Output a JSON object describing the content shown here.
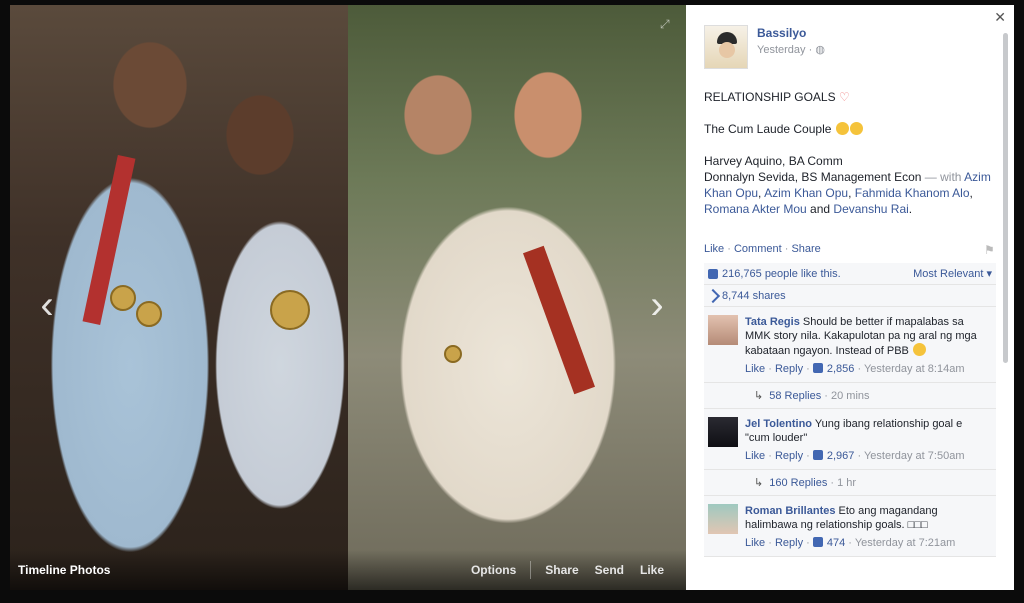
{
  "photo": {
    "album_label": "Timeline Photos",
    "actions": [
      "Options",
      "Share",
      "Send",
      "Like"
    ]
  },
  "post": {
    "author": "Bassilyo",
    "time": "Yesterday",
    "line1": "RELATIONSHIP GOALS",
    "line2": "The Cum Laude Couple",
    "line3a": "Harvey Aquino, BA Comm",
    "line3b": "Donnalyn Sevida, BS Management Econ",
    "with_text": " — with ",
    "tagged": [
      "Azim Khan Opu",
      "Azim Khan Opu",
      "Fahmida Khanom Alo",
      "Romana Akter Mou",
      "Devanshu Rai"
    ],
    "and_text": " and ",
    "actions": {
      "like": "Like",
      "comment": "Comment",
      "share": "Share"
    }
  },
  "ufi": {
    "likes": "216,765 people like this.",
    "sort": "Most Relevant",
    "shares": "8,744 shares"
  },
  "comments": [
    {
      "name": "Tata Regis",
      "text": "Should be better if mapalabas sa MMK story nila. Kakapulotan pa ng aral ng mga kabataan ngayon. Instead of PBB",
      "like": "Like",
      "reply": "Reply",
      "count": "2,856",
      "time": "Yesterday at 8:14am",
      "replies": "58 Replies",
      "replies_time": "20 mins"
    },
    {
      "name": "Jel Tolentino",
      "text": "Yung ibang relationship goal e \"cum louder\"",
      "like": "Like",
      "reply": "Reply",
      "count": "2,967",
      "time": "Yesterday at 7:50am",
      "replies": "160 Replies",
      "replies_time": "1 hr"
    },
    {
      "name": "Roman Brillantes",
      "text": "Eto ang magandang halimbawa ng relationship goals. □□□",
      "like": "Like",
      "reply": "Reply",
      "count": "474",
      "time": "Yesterday at 7:21am"
    }
  ]
}
